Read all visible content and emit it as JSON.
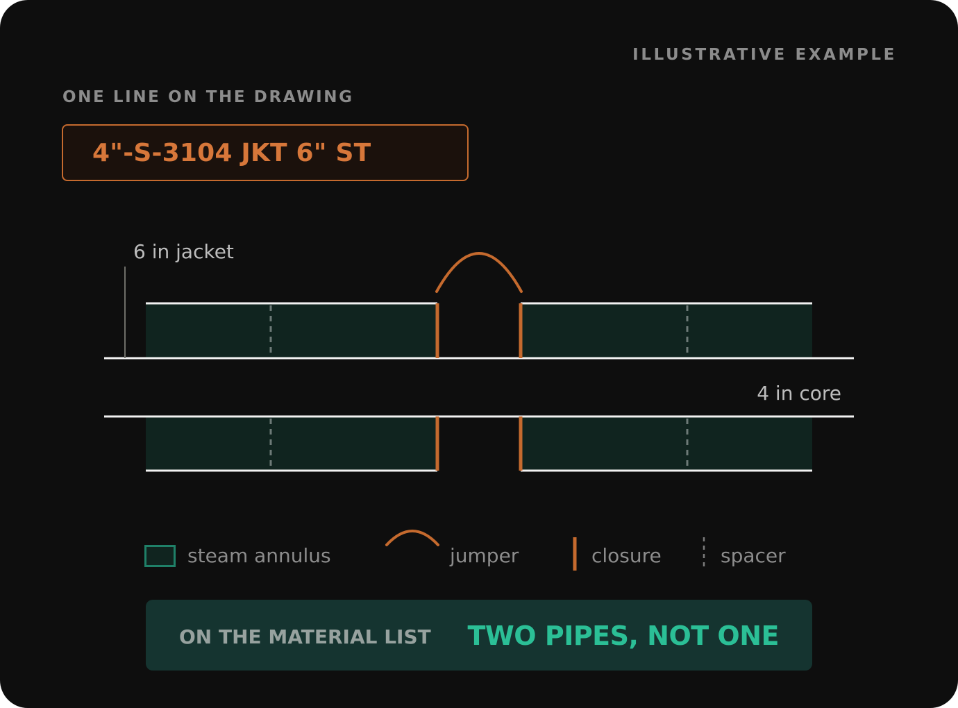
{
  "header": {
    "tag": "ILLUSTRATIVE EXAMPLE",
    "section_label": "ONE LINE ON THE DRAWING",
    "line_code": "4\"-S-3104 JKT 6\" ST"
  },
  "diagram": {
    "jacket_label": "6 in jacket",
    "core_label": "4 in core"
  },
  "legend": {
    "annulus": "steam annulus",
    "jumper": "jumper",
    "closure": "closure",
    "spacer": "spacer"
  },
  "result": {
    "label": "ON THE MATERIAL LIST",
    "value": "TWO PIPES, NOT ONE"
  },
  "colors": {
    "background": "#0e0e0e",
    "accent": "#c56a2e",
    "annulus_fill": "#10241f",
    "result_bg": "#153430",
    "result_text": "#2bbf96",
    "muted_text": "#8c8c8c"
  }
}
